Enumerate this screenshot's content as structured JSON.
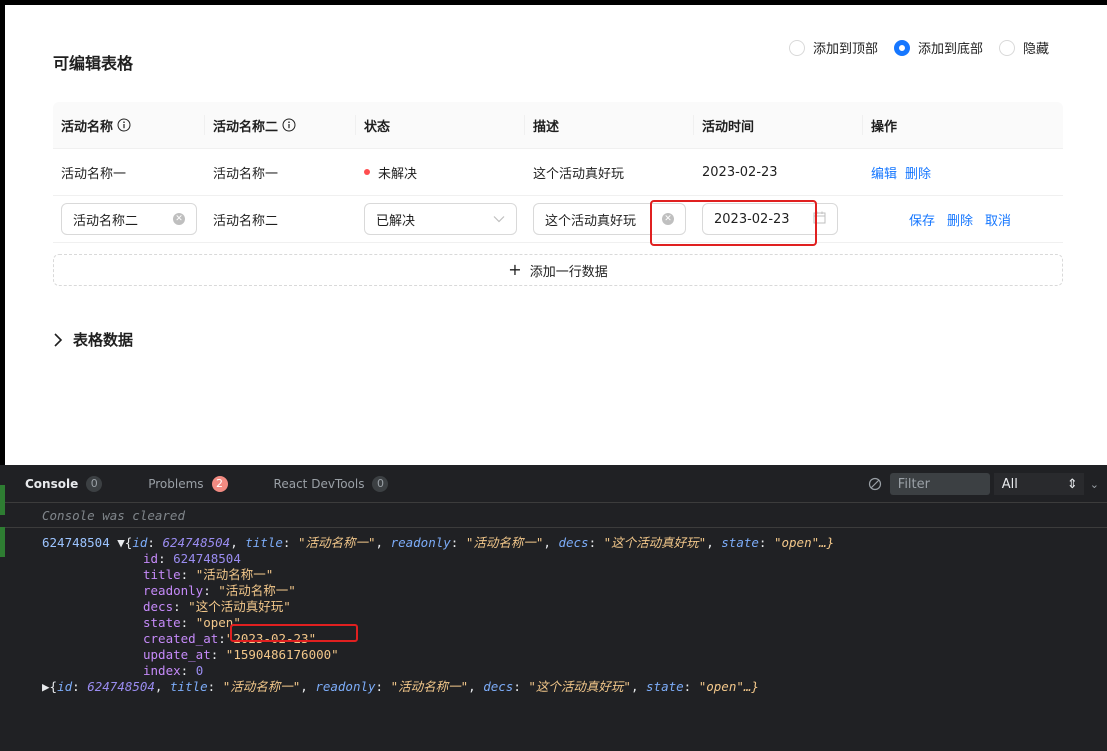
{
  "table_page": {
    "title": "可编辑表格",
    "position_options": [
      {
        "label": "添加到顶部",
        "checked": false
      },
      {
        "label": "添加到底部",
        "checked": true
      },
      {
        "label": "隐藏",
        "checked": false
      }
    ],
    "columns": [
      "活动名称",
      "活动名称二",
      "状态",
      "描述",
      "活动时间",
      "操作"
    ],
    "row1": {
      "name": "活动名称一",
      "name2": "活动名称一",
      "status": "未解决",
      "desc": "这个活动真好玩",
      "date": "2023-02-23",
      "actions": [
        "编辑",
        "删除"
      ]
    },
    "row2": {
      "name": "活动名称二",
      "name2": "活动名称二",
      "status": "已解决",
      "desc": "这个活动真好玩",
      "date": "2023-02-23",
      "actions": [
        "保存",
        "删除",
        "取消"
      ]
    },
    "add_row_label": "添加一行数据",
    "collapse_label": "表格数据",
    "status_dot_color": "#ff4d4f",
    "accent_color": "#1677ff"
  },
  "devtools": {
    "tabs": [
      {
        "label": "Console",
        "count": "0"
      },
      {
        "label": "Problems",
        "count": "2"
      },
      {
        "label": "React DevTools",
        "count": "0"
      }
    ],
    "filter_placeholder": "Filter",
    "level": "All",
    "cleared_message": "Console was cleared",
    "log": {
      "prefix": "624748504",
      "summary": {
        "id": "624748504",
        "title": "\"活动名称一\"",
        "readonly": "\"活动名称一\"",
        "decs": "\"这个活动真好玩\"",
        "state": "\"open\"…}"
      },
      "props": [
        {
          "key": "id",
          "value": "624748504"
        },
        {
          "key": "title",
          "value": "\"活动名称一\""
        },
        {
          "key": "readonly",
          "value": "\"活动名称一\""
        },
        {
          "key": "decs",
          "value": "\"这个活动真好玩\""
        },
        {
          "key": "state",
          "value": "\"open\""
        },
        {
          "key": "created_at",
          "value": "\"2023-02-23\""
        },
        {
          "key": "update_at",
          "value": "\"1590486176000\""
        },
        {
          "key": "index",
          "value": "0"
        }
      ],
      "summary2": {
        "id": "624748504",
        "title": "\"活动名称一\"",
        "readonly": "\"活动名称一\"",
        "decs": "\"这个活动真好玩\"",
        "state": "\"open\"…}"
      }
    }
  }
}
